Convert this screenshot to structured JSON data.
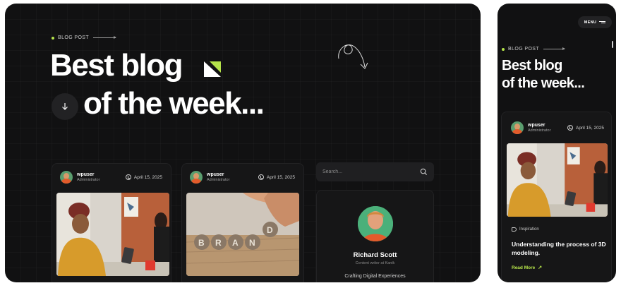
{
  "desktop": {
    "eyebrow": "BLOG POST",
    "title_line1": "Best blog",
    "title_line2": "of the week...",
    "cards": [
      {
        "author": "wpuser",
        "role": "Administrator",
        "date": "April 15, 2025"
      },
      {
        "author": "wpuser",
        "role": "Administrator",
        "date": "April 15, 2025"
      }
    ],
    "search": {
      "placeholder": "Search..."
    },
    "profile": {
      "name": "Richard Scott",
      "role": "Content writer at Kanik",
      "tagline": "Crafting Digital Experiences"
    }
  },
  "mobile": {
    "menu_label": "MENU",
    "eyebrow": "BLOG POST",
    "title_line1": "Best blog",
    "title_line2": "of the week...",
    "card": {
      "author": "wpuser",
      "role": "Administrator",
      "date": "April 15, 2025",
      "category": "Inspiration",
      "post_title": "Understanding the process of 3D modeling.",
      "read_more": "Read More"
    }
  },
  "icons": {
    "down_arrow": "arrow-down-icon",
    "search": "search-icon",
    "clock": "clock-icon",
    "tag": "tag-icon",
    "menu": "hamburger-icon",
    "read_more_arrow": "arrow-up-right-icon"
  },
  "colors": {
    "background": "#111112",
    "accent": "#b5e34a",
    "card": "#161617"
  }
}
